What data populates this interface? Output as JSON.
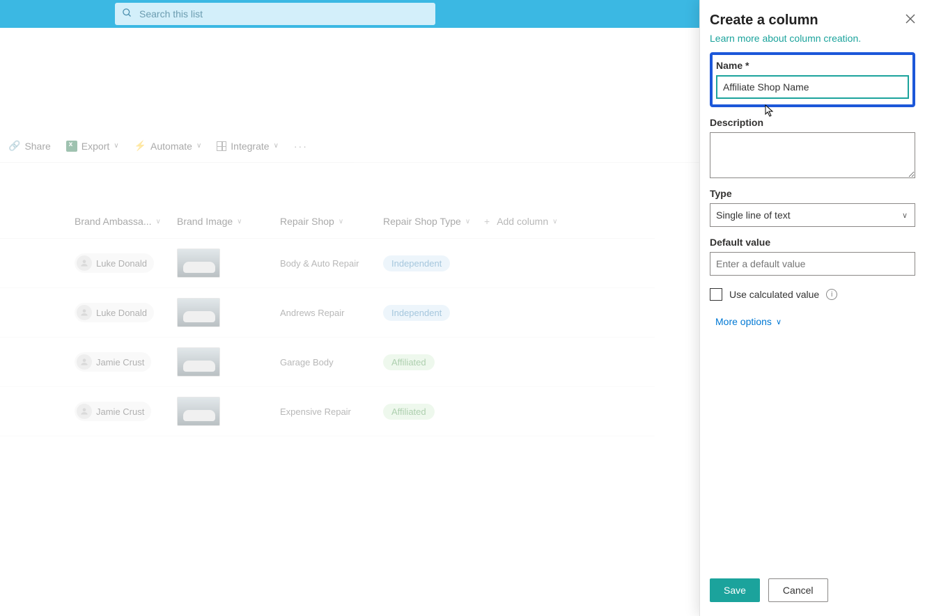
{
  "search": {
    "placeholder": "Search this list"
  },
  "toolbar": {
    "share": "Share",
    "export": "Export",
    "automate": "Automate",
    "integrate": "Integrate"
  },
  "columns": {
    "brand_ambassador": "Brand Ambassa...",
    "brand_image": "Brand Image",
    "repair_shop": "Repair Shop",
    "repair_shop_type": "Repair Shop Type",
    "add_column": "Add column"
  },
  "rows": [
    {
      "person": "Luke Donald",
      "repair_shop": "Body & Auto Repair",
      "type_label": "Independent",
      "type_style": "blue"
    },
    {
      "person": "Luke Donald",
      "repair_shop": "Andrews Repair",
      "type_label": "Independent",
      "type_style": "blue"
    },
    {
      "person": "Jamie Crust",
      "repair_shop": "Garage Body",
      "type_label": "Affiliated",
      "type_style": "green"
    },
    {
      "person": "Jamie Crust",
      "repair_shop": "Expensive Repair",
      "type_label": "Affiliated",
      "type_style": "green"
    }
  ],
  "panel": {
    "title": "Create a column",
    "learn_more": "Learn more about column creation.",
    "name_label": "Name *",
    "name_value": "Affiliate Shop Name",
    "description_label": "Description",
    "type_label": "Type",
    "type_value": "Single line of text",
    "default_label": "Default value",
    "default_placeholder": "Enter a default value",
    "use_calc": "Use calculated value",
    "more_options": "More options",
    "save": "Save",
    "cancel": "Cancel"
  }
}
